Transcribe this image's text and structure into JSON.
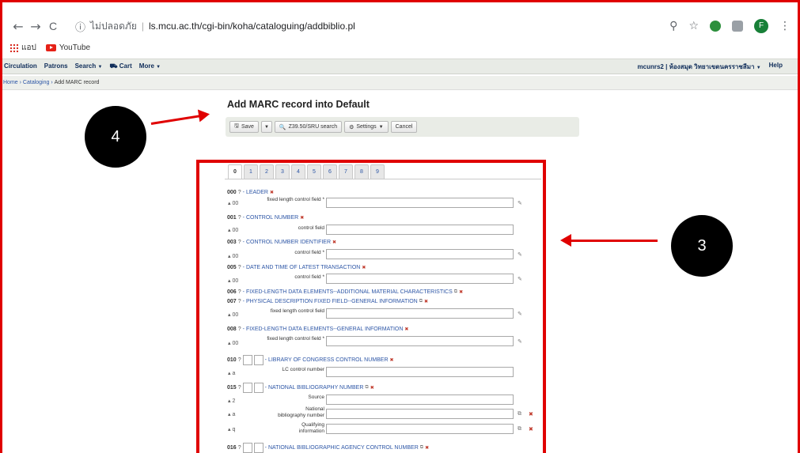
{
  "browser": {
    "nav": {
      "back": "←",
      "forward": "→",
      "reload": "C"
    },
    "security_text": "ไม่ปลอดภัย",
    "url": "ls.mcu.ac.th/cgi-bin/koha/cataloguing/addbiblio.pl",
    "profile_initial": "F",
    "bookmarks": [
      {
        "label": "แอป",
        "icon": "apps-icon"
      },
      {
        "label": "YouTube",
        "icon": "youtube-icon"
      }
    ]
  },
  "navbar": {
    "left": [
      "Circulation",
      "Patrons",
      "Search",
      "Cart",
      "More"
    ],
    "user": "mcunrs2",
    "library": "ห้องสมุด วิทยาเขตนครราชสีมา",
    "help": "Help"
  },
  "breadcrumb": {
    "home": "Home",
    "cataloging": "Cataloging",
    "current": "Add MARC record"
  },
  "page_title": "Add MARC record into Default",
  "toolbar": {
    "save": "Save",
    "z3950": "Z39.50/SRU search",
    "settings": "Settings",
    "cancel": "Cancel"
  },
  "tabs": [
    "0",
    "1",
    "2",
    "3",
    "4",
    "5",
    "6",
    "7",
    "8",
    "9"
  ],
  "fields": [
    {
      "tag": "000",
      "name": "LEADER",
      "sub": "00",
      "label": "fixed length control field *"
    },
    {
      "tag": "001",
      "name": "CONTROL NUMBER",
      "sub": "00",
      "label": "control field"
    },
    {
      "tag": "003",
      "name": "CONTROL NUMBER IDENTIFIER",
      "sub": "00",
      "label": "control field *"
    },
    {
      "tag": "005",
      "name": "DATE AND TIME OF LATEST TRANSACTION",
      "sub": "00",
      "label": "control field *"
    },
    {
      "tag": "006",
      "name": "FIXED-LENGTH DATA ELEMENTS--ADDITIONAL MATERIAL CHARACTERISTICS"
    },
    {
      "tag": "007",
      "name": "PHYSICAL DESCRIPTION FIXED FIELD--GENERAL INFORMATION",
      "sub": "00",
      "label": "fixed length control field"
    },
    {
      "tag": "008",
      "name": "FIXED-LENGTH DATA ELEMENTS--GENERAL INFORMATION",
      "sub": "00",
      "label": "fixed length control field *"
    },
    {
      "tag": "010",
      "name": "LIBRARY OF CONGRESS CONTROL NUMBER",
      "sub": "a",
      "label": "LC control number"
    },
    {
      "tag": "015",
      "name": "NATIONAL BIBLIOGRAPHY NUMBER",
      "subs": [
        {
          "code": "2",
          "label": "Source"
        },
        {
          "code": "a",
          "label": "National bibliography number"
        },
        {
          "code": "q",
          "label": "Qualifying information"
        }
      ]
    },
    {
      "tag": "016",
      "name": "NATIONAL BIBLIOGRAPHIC AGENCY CONTROL NUMBER"
    }
  ],
  "annotations": {
    "marker_3": "3",
    "marker_4": "4"
  },
  "colors": {
    "annotation_red": "#e00000",
    "link_blue": "#2d56a6",
    "navbar_bg": "#e8ebe6"
  }
}
